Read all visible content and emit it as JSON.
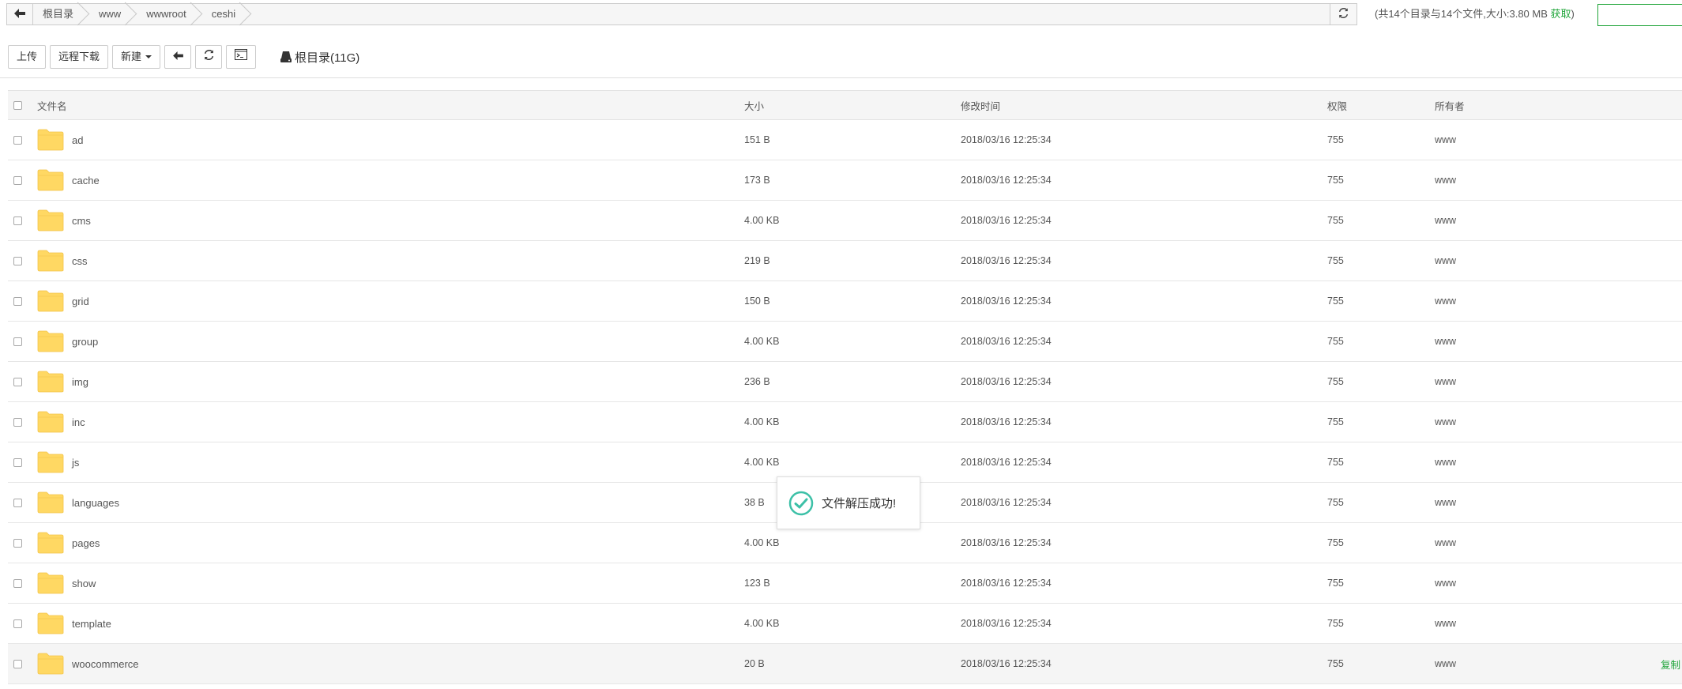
{
  "path_bar": {
    "crumbs": [
      "根目录",
      "www",
      "wwwroot",
      "ceshi"
    ],
    "summary_prefix": "(共14个目录与14个文件,大小:3.80 MB",
    "summary_fetch": "获取",
    "summary_suffix": ")"
  },
  "toolbar": {
    "upload_label": "上传",
    "remote_download_label": "远程下载",
    "new_label": "新建",
    "disk_label": "根目录(11G)"
  },
  "table": {
    "columns": {
      "name": "文件名",
      "size": "大小",
      "mtime": "修改时间",
      "perm": "权限",
      "owner": "所有者"
    },
    "rows": [
      {
        "name": "ad",
        "size": "151 B",
        "mtime": "2018/03/16 12:25:34",
        "perm": "755",
        "owner": "www"
      },
      {
        "name": "cache",
        "size": "173 B",
        "mtime": "2018/03/16 12:25:34",
        "perm": "755",
        "owner": "www"
      },
      {
        "name": "cms",
        "size": "4.00 KB",
        "mtime": "2018/03/16 12:25:34",
        "perm": "755",
        "owner": "www"
      },
      {
        "name": "css",
        "size": "219 B",
        "mtime": "2018/03/16 12:25:34",
        "perm": "755",
        "owner": "www"
      },
      {
        "name": "grid",
        "size": "150 B",
        "mtime": "2018/03/16 12:25:34",
        "perm": "755",
        "owner": "www"
      },
      {
        "name": "group",
        "size": "4.00 KB",
        "mtime": "2018/03/16 12:25:34",
        "perm": "755",
        "owner": "www"
      },
      {
        "name": "img",
        "size": "236 B",
        "mtime": "2018/03/16 12:25:34",
        "perm": "755",
        "owner": "www"
      },
      {
        "name": "inc",
        "size": "4.00 KB",
        "mtime": "2018/03/16 12:25:34",
        "perm": "755",
        "owner": "www"
      },
      {
        "name": "js",
        "size": "4.00 KB",
        "mtime": "2018/03/16 12:25:34",
        "perm": "755",
        "owner": "www"
      },
      {
        "name": "languages",
        "size": "38 B",
        "mtime": "2018/03/16 12:25:34",
        "perm": "755",
        "owner": "www"
      },
      {
        "name": "pages",
        "size": "4.00 KB",
        "mtime": "2018/03/16 12:25:34",
        "perm": "755",
        "owner": "www"
      },
      {
        "name": "show",
        "size": "123 B",
        "mtime": "2018/03/16 12:25:34",
        "perm": "755",
        "owner": "www"
      },
      {
        "name": "template",
        "size": "4.00 KB",
        "mtime": "2018/03/16 12:25:34",
        "perm": "755",
        "owner": "www"
      },
      {
        "name": "woocommerce",
        "size": "20 B",
        "mtime": "2018/03/16 12:25:34",
        "perm": "755",
        "owner": "www",
        "hover_action": "复制"
      }
    ]
  },
  "toast": {
    "message": "文件解压成功!"
  },
  "colors": {
    "accent_green": "#20a53a",
    "folder_yellow": "#ffd863",
    "toast_check": "#3cc0a7"
  },
  "icons": [
    "back-arrow-icon",
    "refresh-icon",
    "terminal-icon",
    "hard-disk-icon",
    "folder-icon",
    "check-circle-icon"
  ]
}
